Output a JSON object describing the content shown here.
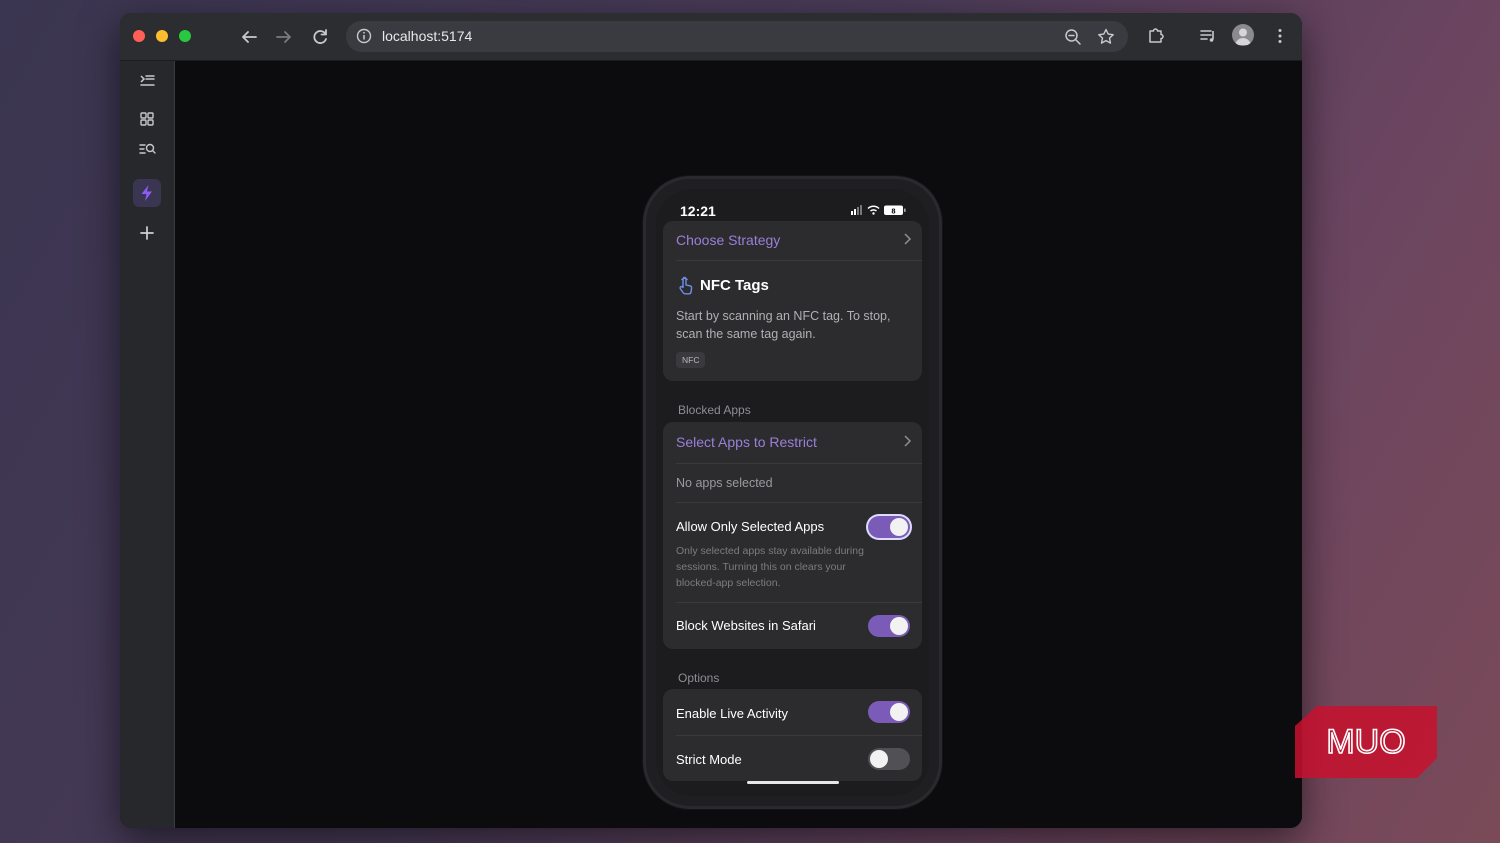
{
  "browser": {
    "url": "localhost:5174"
  },
  "phone": {
    "status": {
      "time": "12:21",
      "battery": "8"
    },
    "strategy": {
      "choose_label": "Choose Strategy",
      "title": "NFC Tags",
      "description": "Start by scanning an NFC tag. To stop, scan the same tag again.",
      "badge": "NFC"
    },
    "blocked_apps": {
      "section_label": "Blocked Apps",
      "select_label": "Select Apps to Restrict",
      "status": "No apps selected",
      "allow_only_label": "Allow Only Selected Apps",
      "allow_only_hint": "Only selected apps stay available during sessions. Turning this on clears your blocked-app selection.",
      "allow_only_on": true,
      "block_websites_label": "Block Websites in Safari",
      "block_websites_on": true
    },
    "options": {
      "section_label": "Options",
      "live_activity_label": "Enable Live Activity",
      "live_activity_on": true,
      "strict_mode_label": "Strict Mode",
      "strict_mode_on": false
    }
  },
  "watermark": {
    "text": "MUO",
    "color": "#c8102e"
  },
  "colors": {
    "accent": "#9a7fd9",
    "toggle_on": "#7b5bb8"
  }
}
